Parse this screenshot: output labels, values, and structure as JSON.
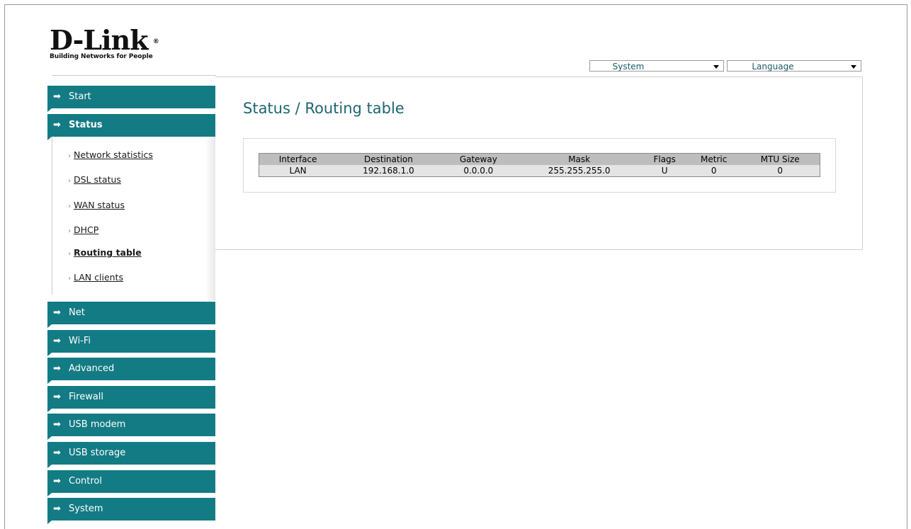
{
  "logo": {
    "name": "D-Link",
    "reg": "®",
    "tagline": "Building Networks for People"
  },
  "top_selects": {
    "system": {
      "value": "System"
    },
    "language": {
      "value": "Language"
    }
  },
  "sidebar": {
    "menu_before": [
      {
        "label": "Start",
        "icon": "arrow-right-icon"
      },
      {
        "label": "Status",
        "icon": "arrow-right-icon",
        "active": true
      }
    ],
    "status_submenu": [
      {
        "label": "Network statistics"
      },
      {
        "label": "DSL status"
      },
      {
        "label": "WAN status"
      },
      {
        "label": "DHCP"
      },
      {
        "label": "Routing table",
        "active": true
      },
      {
        "label": "LAN clients"
      }
    ],
    "menu_after": [
      {
        "label": "Net"
      },
      {
        "label": "Wi-Fi"
      },
      {
        "label": "Advanced"
      },
      {
        "label": "Firewall"
      },
      {
        "label": "USB modem"
      },
      {
        "label": "USB storage"
      },
      {
        "label": "Control"
      },
      {
        "label": "System"
      }
    ],
    "bullet": "›",
    "arrow": "➡"
  },
  "main": {
    "title": "Status /  Routing table",
    "routing_table": {
      "columns": [
        "Interface",
        "Destination",
        "Gateway",
        "Mask",
        "Flags",
        "Metric",
        "MTU Size"
      ],
      "rows": [
        [
          "LAN",
          "192.168.1.0",
          "0.0.0.0",
          "255.255.255.0",
          "U",
          "0",
          "0"
        ]
      ]
    }
  },
  "colors": {
    "menu_bg": "#137b84",
    "title": "#1e6670",
    "header_bg": "#bdbdbd",
    "row_bg": "#e4e4e4"
  }
}
